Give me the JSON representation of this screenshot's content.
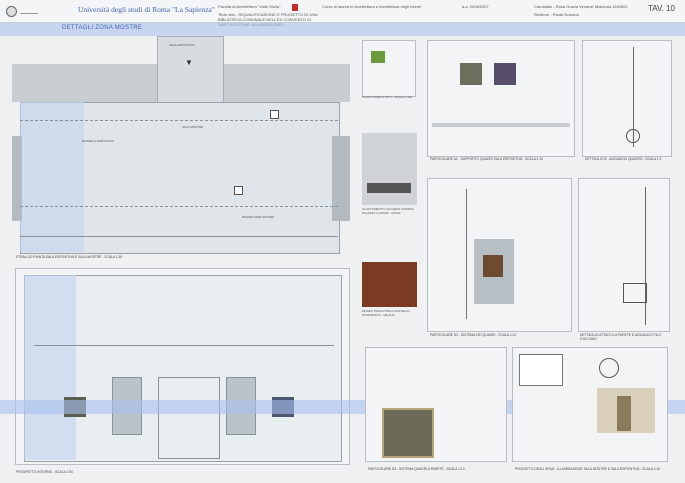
{
  "header": {
    "university": "Università degli studi di Roma \"La Sapienza\"",
    "faculty": "Facoltà di Architettura \"Valle Giulia\"",
    "project_title": "Titolo tesi - RIQUALIFICAZIONE E PROGETTO DI UNA BIBLIOTECA COMUNALE NELL'EX CONVENTO DI SANT'AGOSTINO AD ANDRIA (BAT)",
    "course": "Corso di laurea in Architettura e Architettura degli Interni",
    "year": "a.a. 2006/2007",
    "candidate_label": "Candidato - Rosa Grazia Venanzi",
    "matricola": "Matricola 1162602",
    "relatore": "Relatore - Paola Scarano",
    "sheet": "TAV. 10"
  },
  "section_title": "DETTAGLI ZONA MOSTRE",
  "captions": {
    "plan": "STRALCIO PIANTA SALA ESPOSITIVA E SALA MOSTRE - SCALA 1:50",
    "elevation": "PROSPETTO INTERNO - SCALA 1:50",
    "ceiling_photo": "PIANTA PARETI TIPO - SCALA 1:100",
    "gallery_photo": "ALLESTIMENTO GALLERIA CORSINI, PALAZZO CORSINI - ROMA",
    "fresco_photo": "MUSEO PINACOTECA CASTELLO SFORZESCO - MILANO",
    "detail_a1": "PARTICOLARE A1 - SUPPORTO QUADRI SALA ESPOSITIVA - SCALA 1:10",
    "detail_b": "DETTAGLIO B - AGGANCIO QUADRO - SCALA 1:2",
    "detail_d2": "PARTICOLARE D2 - SISTEMA DEI QUADRI - SCALA 1:10",
    "detail_c": "DETTAGLIO ATTACCO A PARETE E AGGANCIO FILO D'ACCIAIO",
    "detail_d3": "PARTICOLARE D3 - SISTEMA QUADRI A PARETE - SCALA 1:10",
    "detail_proj": "PROGETTO DEGLI SPAZI - ILLUMINAZIONE SALA MOSTRE E SALA ESPOSITIVA - SCALA 1:10"
  },
  "plan_labels": {
    "entrance": "SALA ESPOSITIVA",
    "hall": "SALA MOSTRE",
    "note1": "PANNELLI ESPOSITIVI",
    "note2": "BINARIO PER SISTEMI"
  },
  "colors": {
    "accent": "#3f63b0",
    "band": "#a9bff0",
    "panel_bg": "#f2f4f5"
  }
}
